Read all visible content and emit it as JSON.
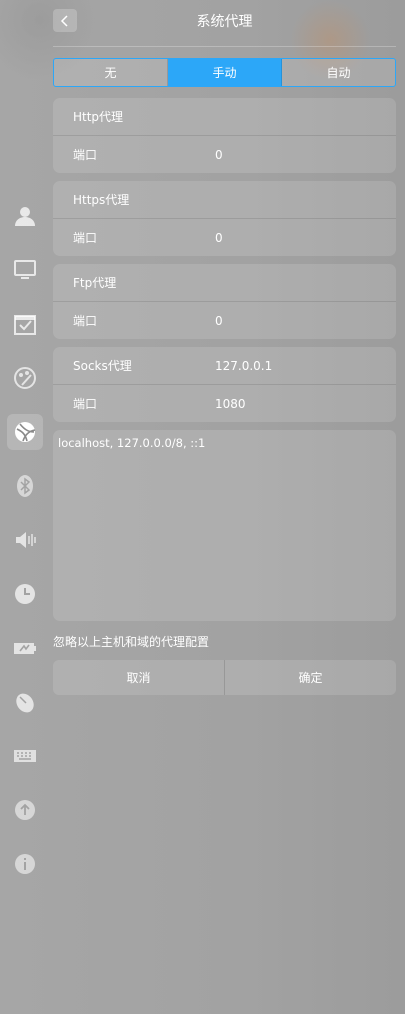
{
  "header": {
    "title": "系统代理"
  },
  "mode_tabs": [
    {
      "label": "无",
      "selected": false
    },
    {
      "label": "手动",
      "selected": true
    },
    {
      "label": "自动",
      "selected": false
    }
  ],
  "http": {
    "label": "Http代理",
    "host": "",
    "port_label": "端口",
    "port": "0"
  },
  "https": {
    "label": "Https代理",
    "host": "",
    "port_label": "端口",
    "port": "0"
  },
  "ftp": {
    "label": "Ftp代理",
    "host": "",
    "port_label": "端口",
    "port": "0"
  },
  "socks": {
    "label": "Socks代理",
    "host": "127.0.0.1",
    "port_label": "端口",
    "port": "1080"
  },
  "ignore_hosts": {
    "value": "localhost, 127.0.0.0/8, ::1",
    "label": "忽略以上主机和域的代理配置"
  },
  "buttons": {
    "cancel": "取消",
    "confirm": "确定"
  },
  "colors": {
    "accent": "#2ca7f8"
  },
  "sidebar_icons": [
    "account-icon",
    "display-icon",
    "calendar-icon",
    "personalization-icon",
    "network-icon",
    "bluetooth-icon",
    "sound-icon",
    "time-icon",
    "power-icon",
    "mouse-icon",
    "keyboard-icon",
    "update-icon",
    "info-icon"
  ]
}
